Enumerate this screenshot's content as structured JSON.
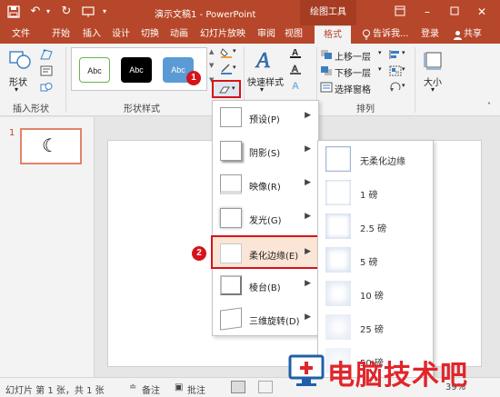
{
  "titlebar": {
    "title": "演示文稿1 - PowerPoint",
    "context_tools": "绘图工具",
    "undo_label": "↶",
    "redo_label": "↻"
  },
  "tabs": {
    "file": "文件",
    "home": "开始",
    "insert": "插入",
    "design": "设计",
    "transitions": "切换",
    "animations": "动画",
    "slideshow": "幻灯片放映",
    "review": "审阅",
    "view": "视图",
    "format": "格式",
    "tell_me": "告诉我...",
    "sign_in": "登录",
    "share": "共享"
  },
  "ribbon": {
    "shape_label": "形状",
    "insert_shapes_group": "插入形状",
    "shape_styles_group": "形状样式",
    "style_samples": [
      "Abc",
      "Abc",
      "Abc"
    ],
    "quick_styles": "快速样式",
    "bring_forward": "上移一层",
    "send_backward": "下移一层",
    "selection_pane": "选择窗格",
    "arrange_group": "排列",
    "size_label": "大小"
  },
  "callouts": {
    "step1": "1",
    "step2": "2"
  },
  "slides": {
    "thumb_number": "1",
    "moon_glyph": "☾"
  },
  "effects_menu": {
    "items": [
      {
        "label": "预设(P)"
      },
      {
        "label": "阴影(S)"
      },
      {
        "label": "映像(R)"
      },
      {
        "label": "发光(G)"
      },
      {
        "label": "柔化边缘(E)"
      },
      {
        "label": "棱台(B)"
      },
      {
        "label": "三维旋转(D)"
      }
    ]
  },
  "soft_edges_menu": {
    "items": [
      {
        "label": "无柔化边缘"
      },
      {
        "label": "1 磅"
      },
      {
        "label": "2.5 磅"
      },
      {
        "label": "5 磅"
      },
      {
        "label": "10 磅"
      },
      {
        "label": "25 磅"
      },
      {
        "label": "50 磅"
      }
    ]
  },
  "statusbar": {
    "slide_info": "幻灯片 第 1 张，共 1 张",
    "notes": "备注",
    "comments": "批注",
    "zoom": "39%"
  },
  "watermark": {
    "text": "电脑技术吧"
  },
  "colors": {
    "accent": "#b7472a",
    "callout_red": "#d6131a",
    "highlight_fill": "#fbe5d6"
  }
}
